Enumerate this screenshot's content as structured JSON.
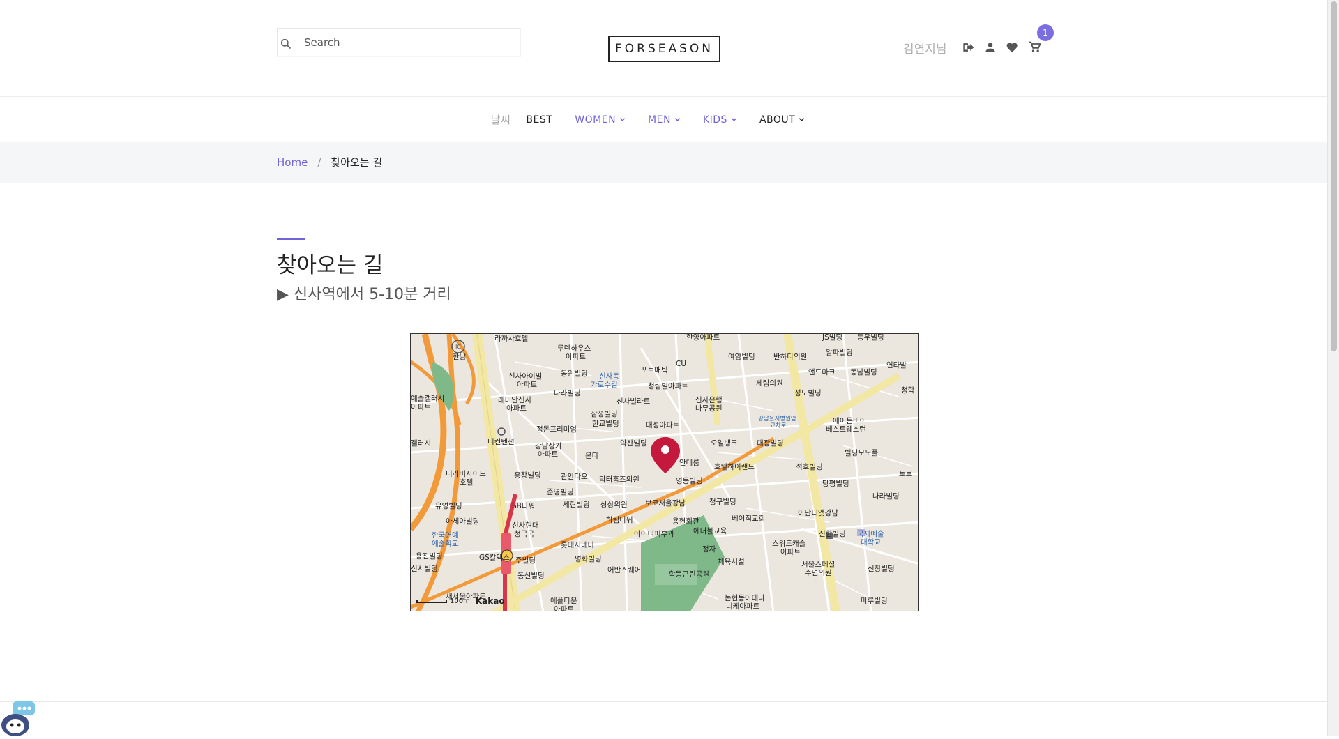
{
  "header": {
    "search_placeholder": "Search",
    "logo": "FORSEASON",
    "user_name": "김연지님",
    "cart_count": "1",
    "icons": [
      "logout-icon",
      "user-icon",
      "heart-icon",
      "cart-icon"
    ]
  },
  "nav": {
    "weather": "날씨",
    "items": [
      {
        "label": "BEST",
        "dropdown": false
      },
      {
        "label": "WOMEN",
        "dropdown": true
      },
      {
        "label": "MEN",
        "dropdown": true
      },
      {
        "label": "KIDS",
        "dropdown": true
      },
      {
        "label": "ABOUT",
        "dropdown": true
      }
    ]
  },
  "breadcrumb": {
    "home": "Home",
    "separator": "/",
    "current": "찾아오는 길"
  },
  "content": {
    "title": "찾아오는 길",
    "subtitle": "▶ 신사역에서 5-10분 거리"
  },
  "map": {
    "scale_label": "100m",
    "brand": "Kakao",
    "labels": [
      "라까사호텔",
      "한남",
      "루덴하우스 아파트",
      "동원빌딩",
      "신사아이빌 아파트",
      "신사동 가로수길",
      "포토매틱",
      "CU",
      "한양아파트",
      "여암빌딩",
      "반하다의원",
      "JS빌딩",
      "등우빌딩",
      "알파빌딩",
      "연타발",
      "앤드마크",
      "동남빌딩",
      "세림의원",
      "성도빌딩",
      "나라빌딩",
      "래미안신사 아파트",
      "신사빌라트",
      "청림빌아파트",
      "신사은행 나무공원",
      "삼성빌딩",
      "한교빌딩",
      "대성아파트",
      "강남을지병원앞 교차로",
      "에이든바이 베스트웨스턴",
      "더컨벤션",
      "정돈프리미엄",
      "강남상가 아파트",
      "약산빌딩",
      "오일뱅크",
      "대광빌딩",
      "온다",
      "안테룸",
      "호텔하이랜드",
      "빌딩모노폴",
      "석호빌딩",
      "더리버사이드 호텔",
      "흥창빌딩",
      "관안다오",
      "닥터홈즈의원",
      "영동빌딩",
      "당평빌딩",
      "준영빌딩",
      "나라빌딩",
      "유영빌딩",
      "SB타워",
      "세현빌딩",
      "상상의원",
      "보코서울강남",
      "청구빌딩",
      "아난티앳강남",
      "베이직교회",
      "아세아빌딩",
      "신사현대",
      "하림타워",
      "용헌회관",
      "에더블교육",
      "한국연예 예술학교",
      "아이디피부과",
      "신한빌딩",
      "국제예술 대학교",
      "용진빌딩",
      "롯데시네마",
      "명화빌딩",
      "스위트캐슬 아파트",
      "GS칼텍스",
      "정자",
      "체육시설",
      "서울스페셜 수면의원",
      "신창빌딩",
      "동신빌딩",
      "어반스퀘어",
      "학동근린공원",
      "논현동아테나 니케아파트",
      "새서울아파트",
      "마루빌딩",
      "애플타운 아파트",
      "신사역"
    ]
  }
}
